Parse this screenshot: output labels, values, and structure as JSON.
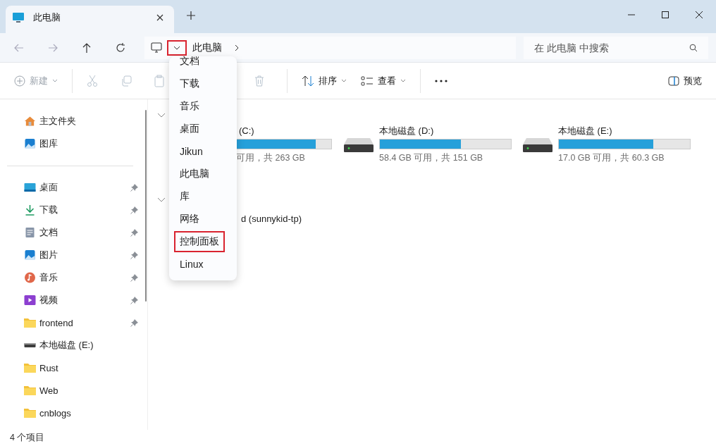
{
  "tabs": [
    {
      "label": "此电脑",
      "selected": true
    }
  ],
  "address": {
    "crumbs": [
      "此电脑"
    ],
    "dropdown_highlighted": true
  },
  "search": {
    "placeholder": "在 此电脑 中搜索"
  },
  "toolbar": {
    "new": {
      "label": "新建",
      "disabled": true
    },
    "sort": {
      "label": "排序",
      "disabled": false
    },
    "view": {
      "label": "查看",
      "disabled": false
    },
    "preview": {
      "label": "预览"
    }
  },
  "sidebar": {
    "top": [
      {
        "label": "主文件夹",
        "kind": "home"
      },
      {
        "label": "图库",
        "kind": "gallery"
      }
    ],
    "items": [
      {
        "label": "桌面",
        "kind": "desktop",
        "pinned": true
      },
      {
        "label": "下载",
        "kind": "download",
        "pinned": true
      },
      {
        "label": "文档",
        "kind": "document",
        "pinned": true
      },
      {
        "label": "图片",
        "kind": "picture",
        "pinned": true
      },
      {
        "label": "音乐",
        "kind": "music",
        "pinned": true
      },
      {
        "label": "视频",
        "kind": "video",
        "pinned": true
      },
      {
        "label": "frontend",
        "kind": "folder",
        "pinned": true
      },
      {
        "label": "本地磁盘 (E:)",
        "kind": "drive",
        "pinned": false
      },
      {
        "label": "Rust",
        "kind": "folder",
        "pinned": false
      },
      {
        "label": "Web",
        "kind": "folder",
        "pinned": false
      },
      {
        "label": "cnblogs",
        "kind": "folder",
        "pinned": false
      }
    ]
  },
  "groups": [
    {
      "expanded": true
    },
    {
      "expanded": true
    }
  ],
  "drives": [
    {
      "name": "(C:)",
      "level": 0.88,
      "free": "可用，共 263 GB",
      "partial": true
    },
    {
      "name": "本地磁盘 (D:)",
      "level": 0.62,
      "free": "58.4 GB 可用，共 151 GB",
      "partial": false
    },
    {
      "name": "本地磁盘 (E:)",
      "level": 0.72,
      "free": "17.0 GB 可用，共 60.3 GB",
      "partial": false
    }
  ],
  "network": [
    {
      "name": "d (sunnykid-tp)"
    }
  ],
  "menu": {
    "items": [
      {
        "label": "文档",
        "highlighted": false
      },
      {
        "label": "下载",
        "highlighted": false
      },
      {
        "label": "音乐",
        "highlighted": false
      },
      {
        "label": "桌面",
        "highlighted": false
      },
      {
        "label": "Jikun",
        "highlighted": false
      },
      {
        "label": "此电脑",
        "highlighted": false
      },
      {
        "label": "库",
        "highlighted": false
      },
      {
        "label": "网络",
        "highlighted": false
      },
      {
        "label": "控制面板",
        "highlighted": true
      },
      {
        "label": "Linux",
        "highlighted": false
      }
    ]
  },
  "status_bar": {
    "count": "4 个项目"
  }
}
